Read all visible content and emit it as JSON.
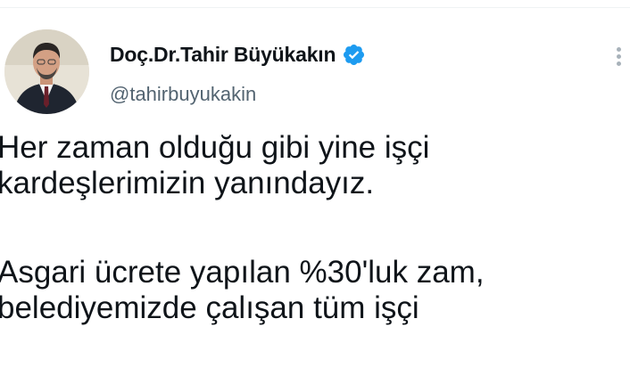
{
  "tweet": {
    "author": {
      "display_name": "Doç.Dr.Tahir Büyükakın",
      "handle": "@tahirbuyukakin",
      "verified_icon": "verified-badge-icon",
      "avatar_icon": "profile-photo"
    },
    "more_icon": "more-options-icon",
    "lines": [
      "Her zaman olduğu gibi yine işçi",
      "kardeşlerimizin yanındayız.",
      "Asgari ücrete yapılan %30'luk zam,",
      "belediyemizde çalışan tüm işçi"
    ]
  },
  "colors": {
    "text": "#0f1419",
    "secondary_text": "#536471",
    "verified_badge": "#1d9bf0"
  }
}
